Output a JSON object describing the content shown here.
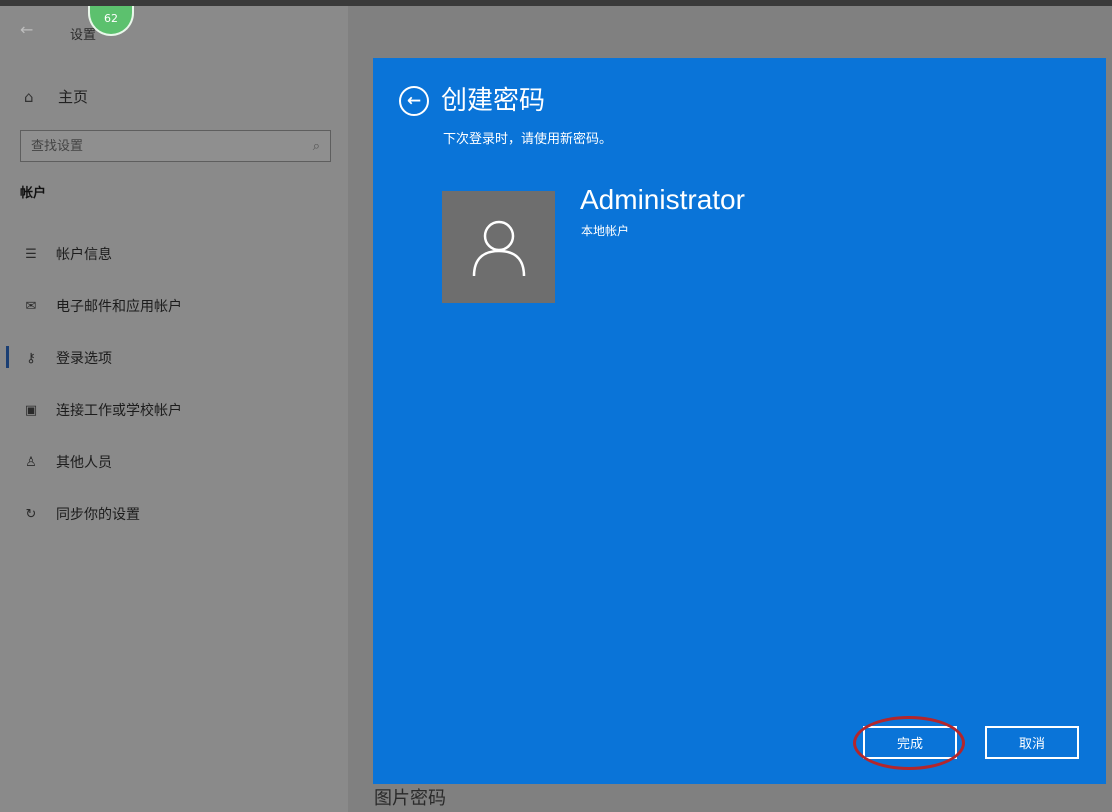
{
  "app": {
    "title": "设置",
    "badge": "62"
  },
  "sidebar": {
    "home_label": "主页",
    "search_placeholder": "查找设置",
    "section_title": "帐户",
    "items": [
      {
        "label": "帐户信息",
        "icon": "account-info-icon"
      },
      {
        "label": "电子邮件和应用帐户",
        "icon": "mail-icon"
      },
      {
        "label": "登录选项",
        "icon": "key-icon",
        "active": true
      },
      {
        "label": "连接工作或学校帐户",
        "icon": "briefcase-icon"
      },
      {
        "label": "其他人员",
        "icon": "add-person-icon"
      },
      {
        "label": "同步你的设置",
        "icon": "sync-icon"
      }
    ]
  },
  "dialog": {
    "title": "创建密码",
    "subtitle": "下次登录时，请使用新密码。",
    "account_name": "Administrator",
    "account_type": "本地帐户",
    "done_label": "完成",
    "cancel_label": "取消",
    "accent_color": "#0a74d8",
    "highlight_color": "#b3262c"
  },
  "background": {
    "partial_text": "图片密码"
  }
}
